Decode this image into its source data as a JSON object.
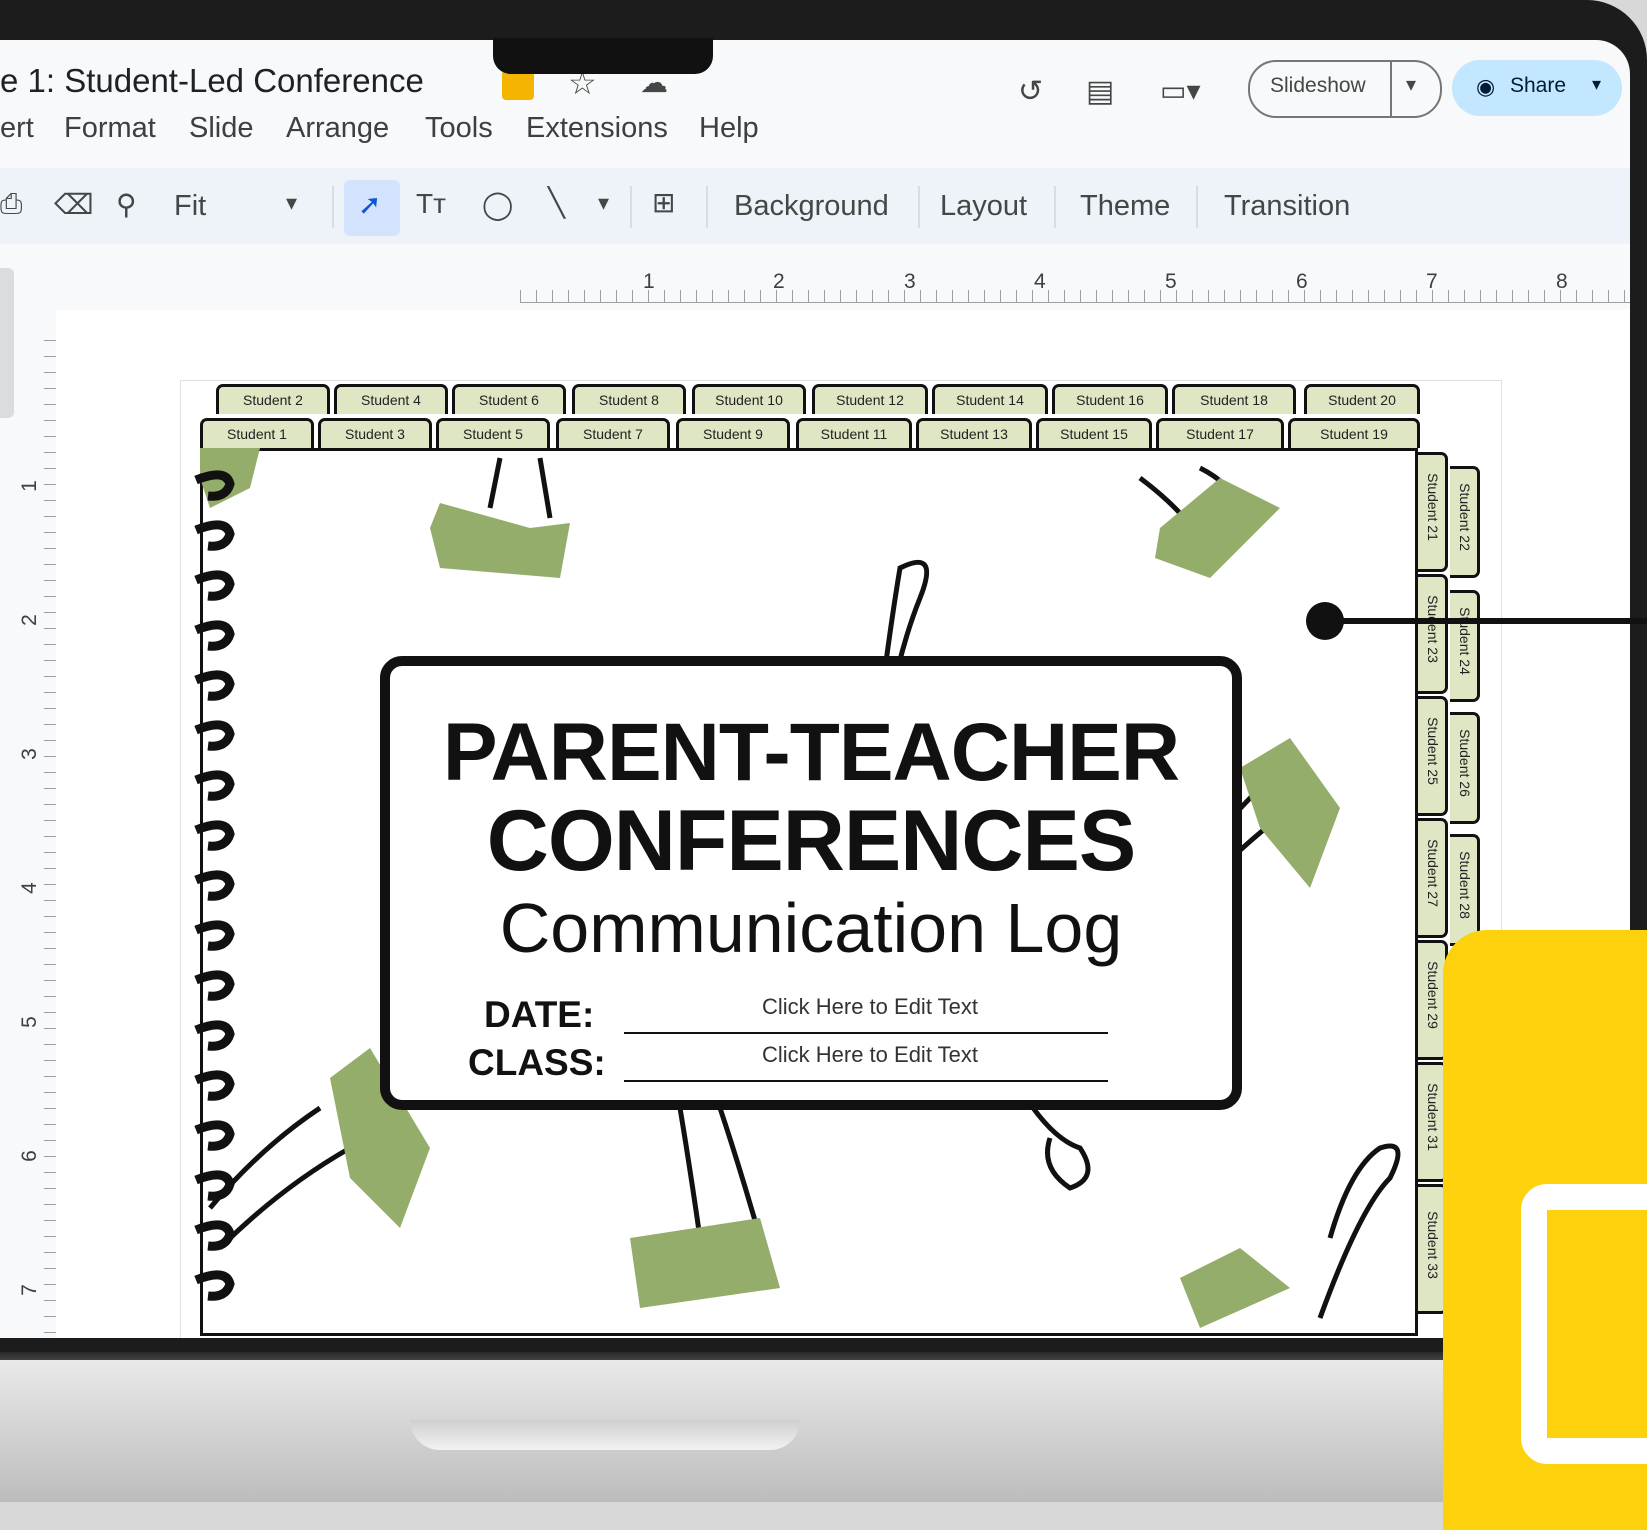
{
  "doc_title": "e 1: Student-Led Conference",
  "menu": [
    "ert",
    "Format",
    "Slide",
    "Arrange",
    "Tools",
    "Extensions",
    "Help"
  ],
  "toolbar": {
    "zoom": "Fit",
    "background": "Background",
    "layout": "Layout",
    "theme": "Theme",
    "transition": "Transition"
  },
  "buttons": {
    "slideshow": "Slideshow",
    "share": "Share"
  },
  "ruler_h": [
    "1",
    "2",
    "3",
    "4",
    "5",
    "6",
    "7",
    "8"
  ],
  "ruler_v": [
    "1",
    "2",
    "3",
    "4",
    "5",
    "6",
    "7"
  ],
  "tabs_top_row1": [
    "Student 2",
    "Student 4",
    "Student 6",
    "Student 8",
    "Student 10",
    "Student 12",
    "Student 14",
    "Student 16",
    "Student 18",
    "Student 20"
  ],
  "tabs_top_row2": [
    "Student 1",
    "Student 3",
    "Student 5",
    "Student 7",
    "Student 9",
    "Student 11",
    "Student 13",
    "Student 15",
    "Student 17",
    "Student 19"
  ],
  "tabs_side_inner": [
    "Student 21",
    "Student 23",
    "Student 25",
    "Student 27",
    "Student 29",
    "Student 31",
    "Student 33"
  ],
  "tabs_side_outer": [
    "Student 22",
    "Student 24",
    "Student 26",
    "Student 28"
  ],
  "slide": {
    "heading1": "PARENT-TEACHER",
    "heading2": "CONFERENCES",
    "subheading": "Communication Log",
    "date_label": "DATE:",
    "date_value": "Click Here to Edit Text",
    "class_label": "CLASS:",
    "class_value": "Click Here to Edit Text"
  },
  "colors": {
    "accent_yellow": "#fdd10c",
    "tab_green": "#dfe6c3",
    "clip_green": "#95ad6a",
    "share_blue": "#c2e7ff"
  }
}
